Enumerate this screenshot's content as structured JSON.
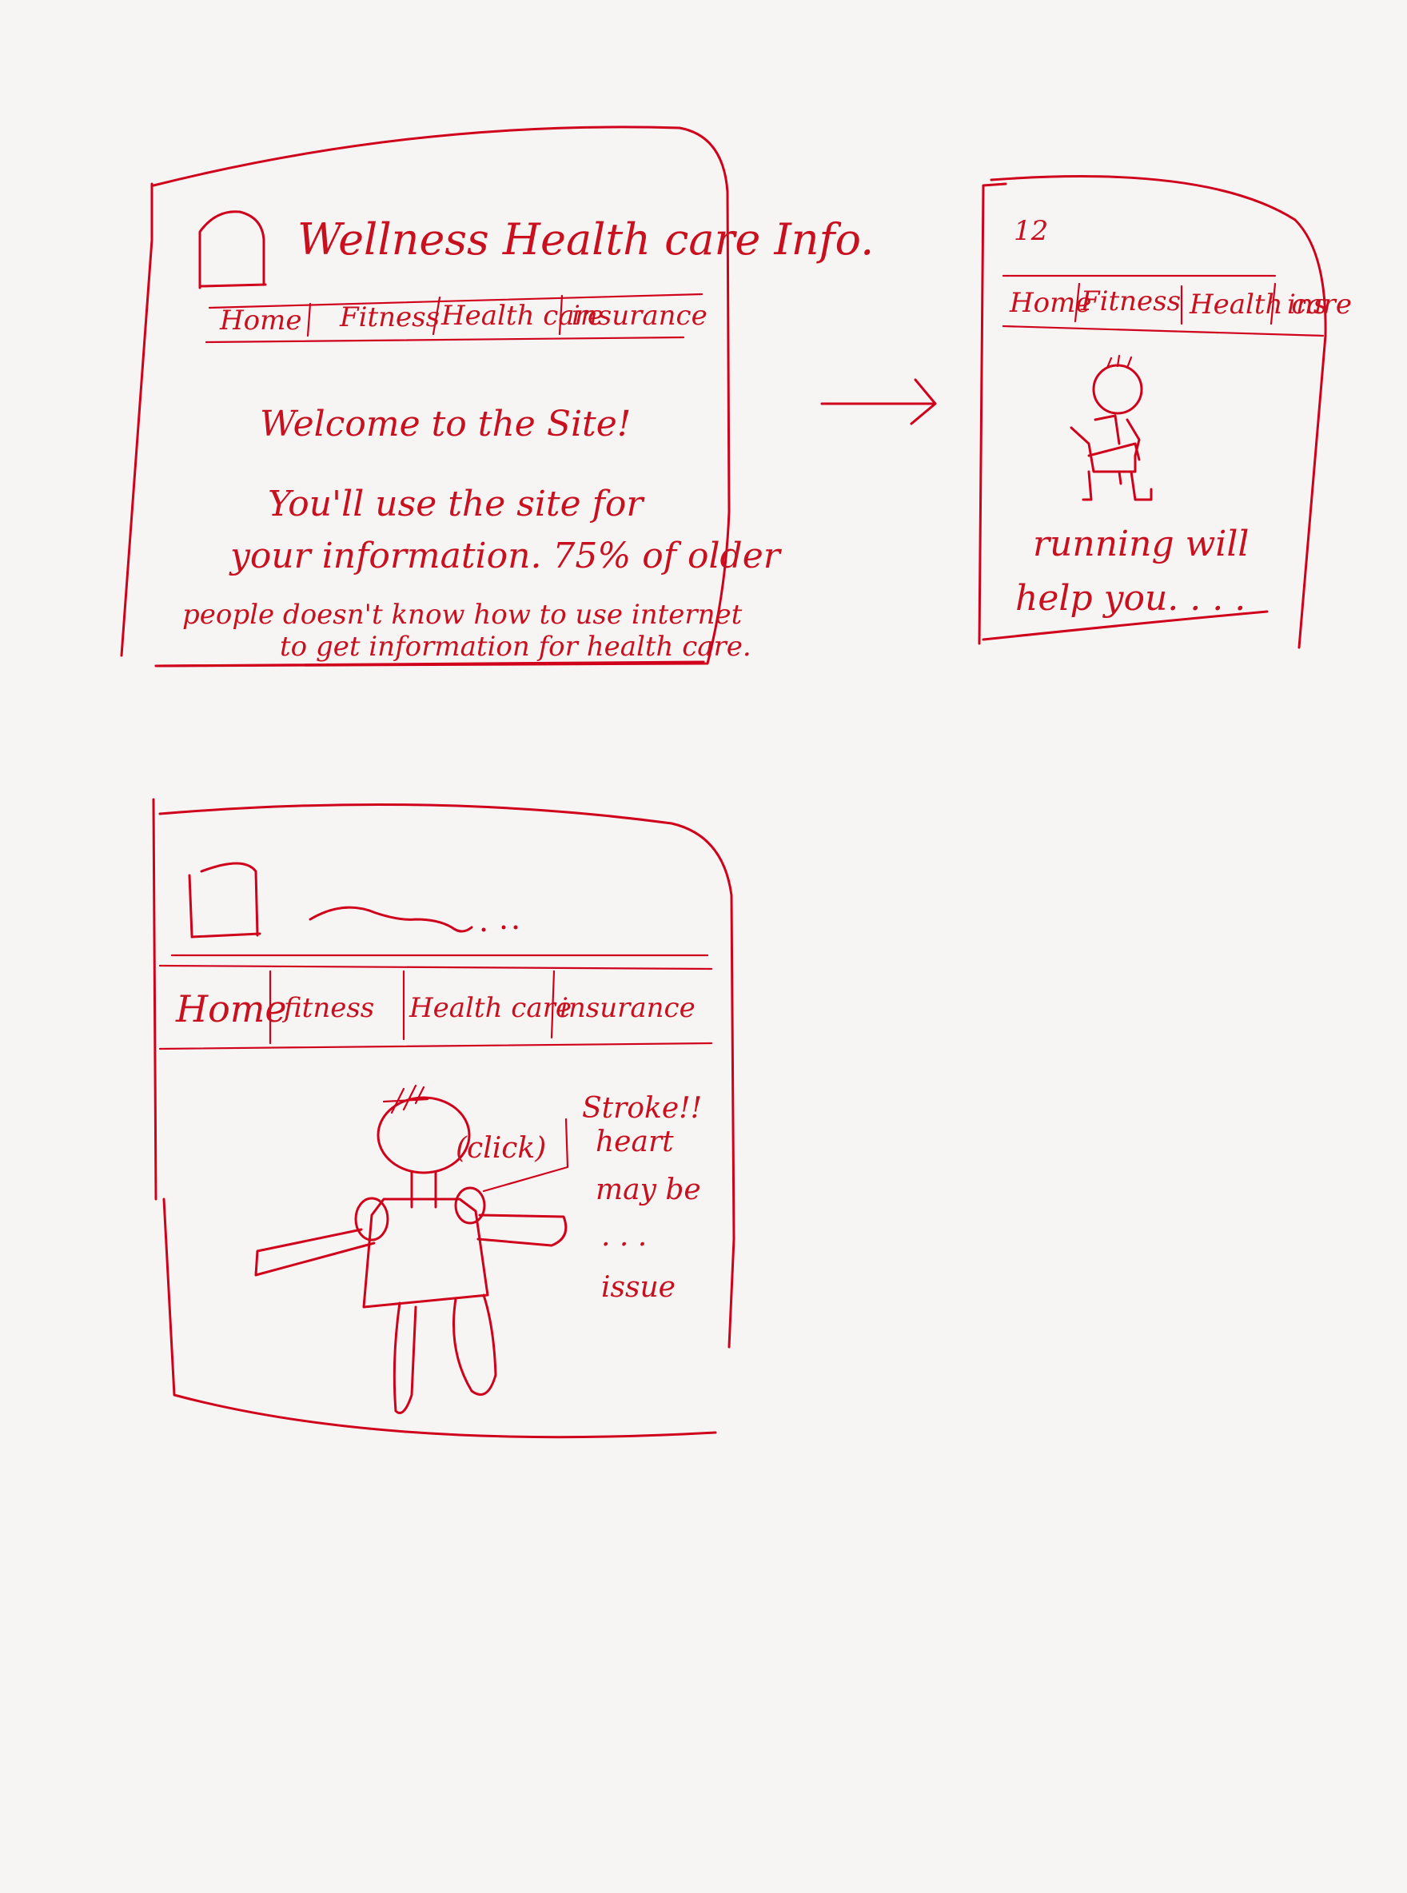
{
  "frame1": {
    "title": "Wellness Health care Info.",
    "nav": [
      "Home",
      "Fitness",
      "Health care",
      "insurance"
    ],
    "welcome": "Welcome to the Site!",
    "body_lines": [
      "You'll use the site for",
      "your information. 75% of older",
      "people doesn't know how to use internet",
      "to get information for health care."
    ]
  },
  "frame2": {
    "header": "12",
    "nav": [
      "Home",
      "Fitness",
      "Health care",
      "ins"
    ],
    "caption_lines": [
      "running will",
      "help you. . . ."
    ]
  },
  "frame3": {
    "title": "~~~ . . .",
    "nav": [
      "Home",
      "fitness",
      "Health care",
      "insurance"
    ],
    "click_label": "(click)",
    "note_lines": [
      "Stroke!!",
      "heart",
      "may be",
      ". . .",
      "issue"
    ]
  },
  "colors": {
    "ink": "#d0021b",
    "paper": "#f6f5f4"
  }
}
